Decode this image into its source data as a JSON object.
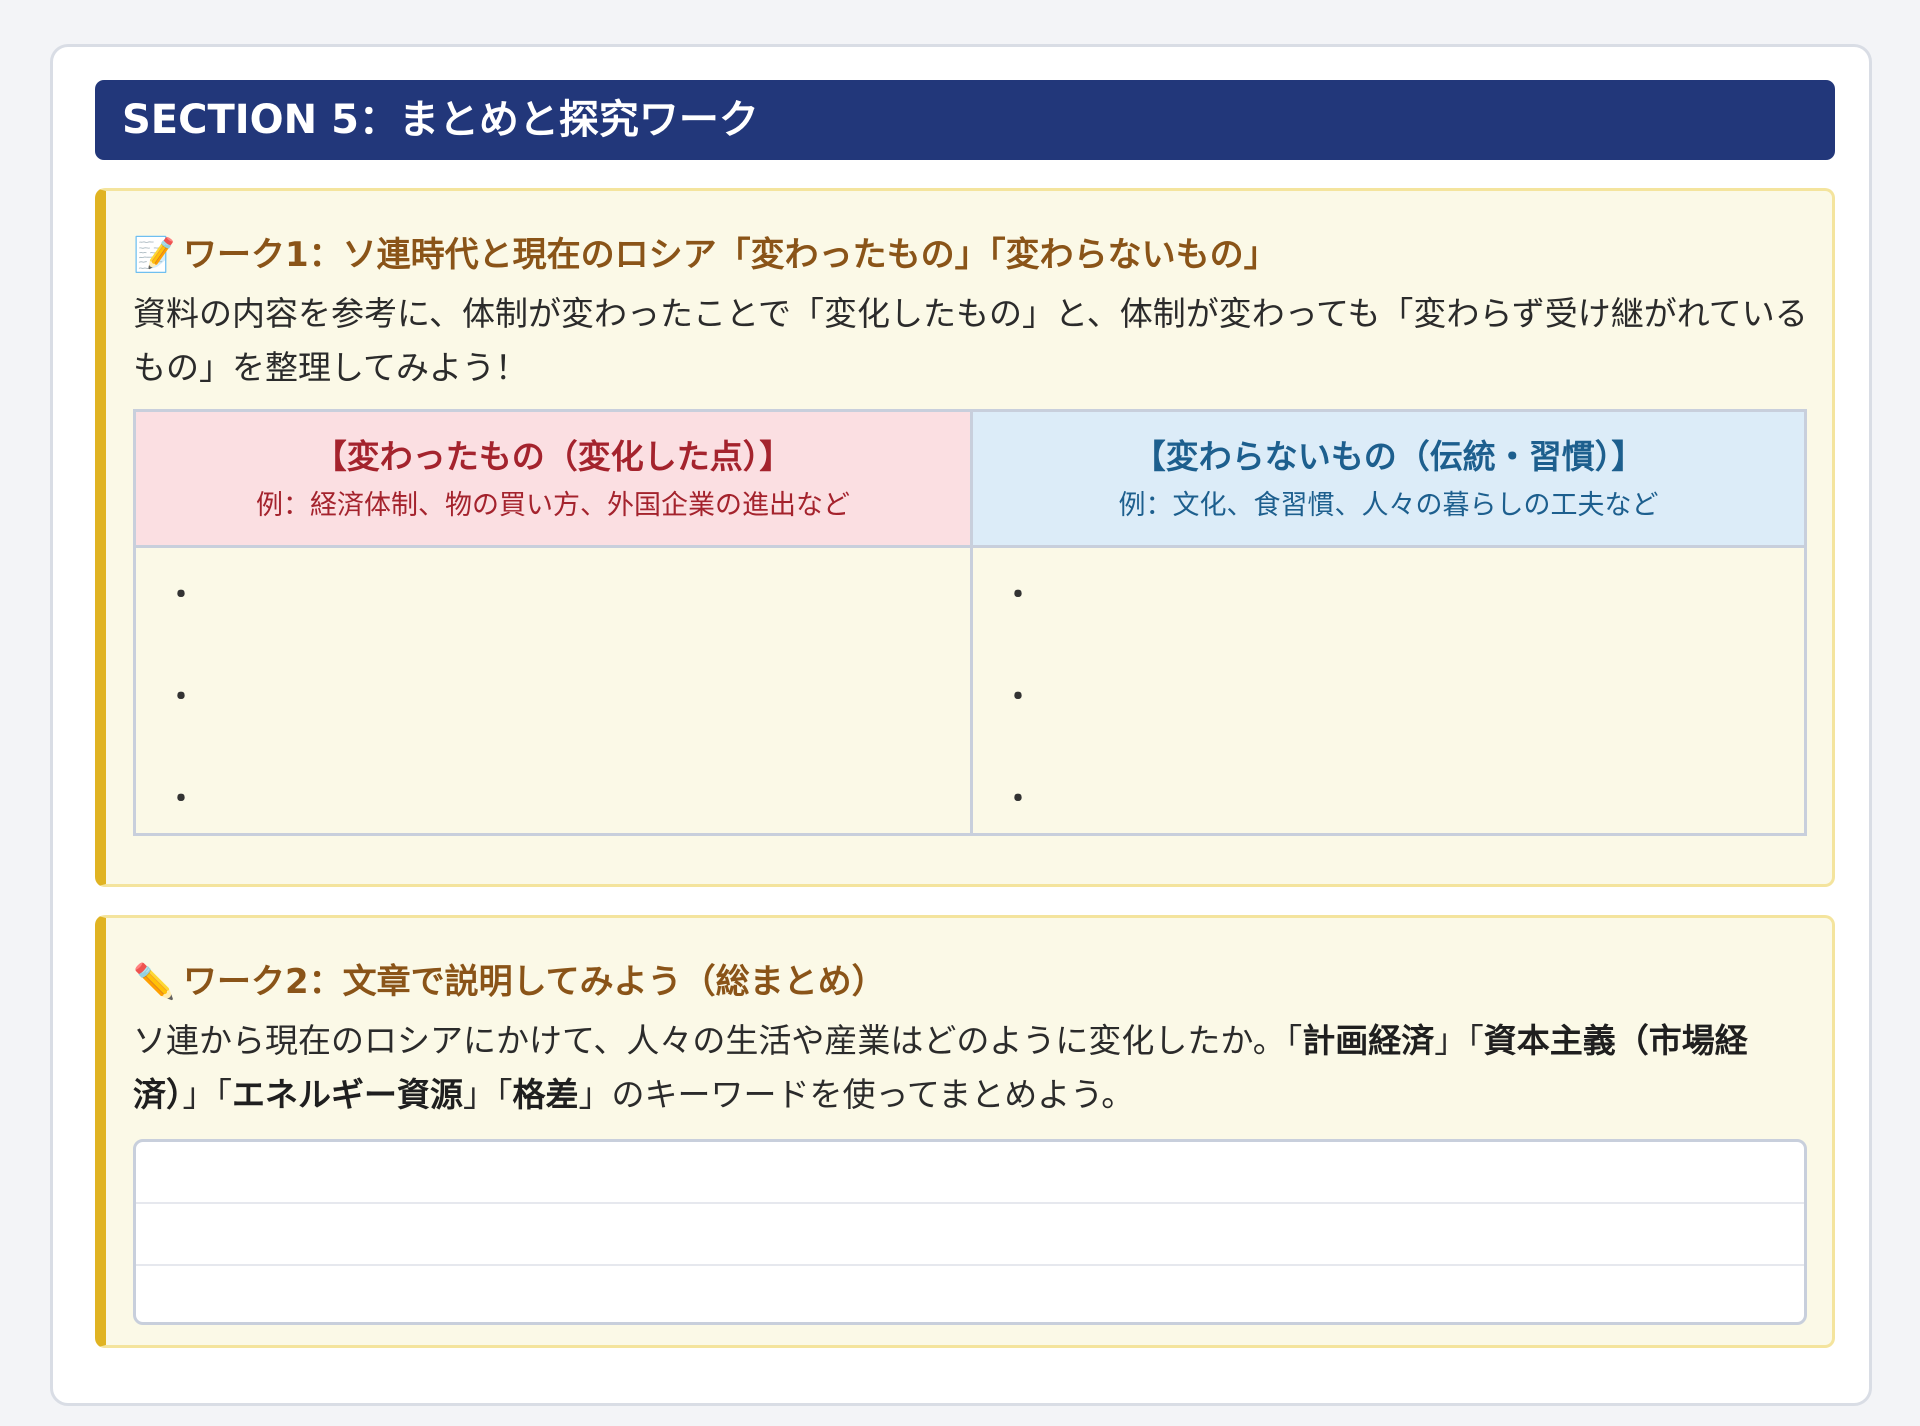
{
  "section": {
    "title": "SECTION 5：まとめと探究ワーク"
  },
  "work1": {
    "icon": "memo-icon",
    "icon_glyph": "📝",
    "title": "ワーク1：ソ連時代と現在のロシア「変わったもの」「変わらないもの」",
    "description": "資料の内容を参考に、体制が変わったことで「変化したもの」と、体制が変わっても「変わらず受け継がれているもの」を整理してみよう！",
    "columns": [
      {
        "title": "【変わったもの（変化した点）】",
        "example": "例：経済体制、物の買い方、外国企業の進出など",
        "bullets": [
          "・",
          "・",
          "・"
        ]
      },
      {
        "title": "【変わらないもの（伝統・習慣）】",
        "example": "例：文化、食習慣、人々の暮らしの工夫など",
        "bullets": [
          "・",
          "・",
          "・"
        ]
      }
    ]
  },
  "work2": {
    "icon": "pencil-icon",
    "icon_glyph": "✏️",
    "title": "ワーク2：文章で説明してみよう（総まとめ）",
    "description": {
      "p1": "ソ連から現在のロシアにかけて、人々の生活や産業はどのように変化したか。「",
      "k1": "計画経済",
      "p2": "」「",
      "k2": "資本主義（市場経済）",
      "p3": "」「",
      "k3": "エネルギー資源",
      "p4": "」「",
      "k4": "格差",
      "p5": "」のキーワードを使ってまとめよう。"
    },
    "answer_lines": 3
  },
  "colors": {
    "header_bg": "#22377a",
    "work_bg": "#fbf9e7",
    "work_accent": "#e0b322",
    "work_title": "#8a5418",
    "changed_bg": "#fbdfe2",
    "changed_text": "#a4232d",
    "unchanged_bg": "#dcecf8",
    "unchanged_text": "#1d5f8e"
  }
}
